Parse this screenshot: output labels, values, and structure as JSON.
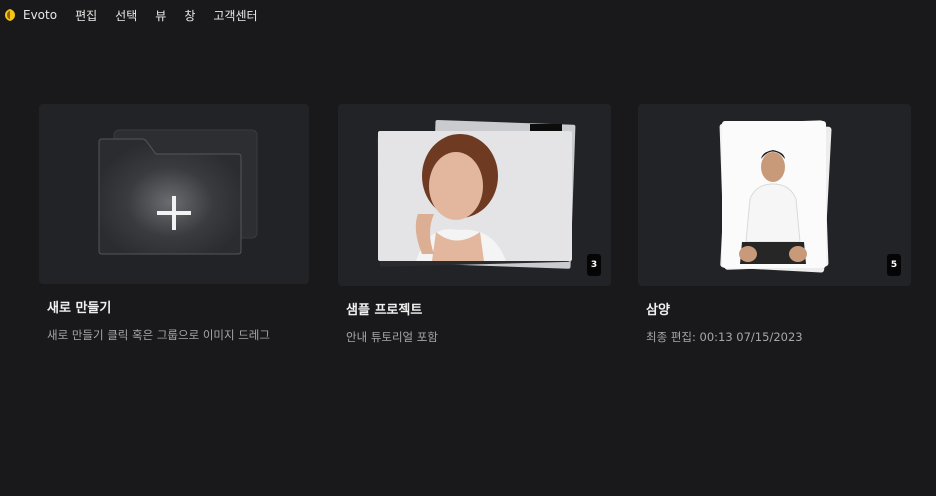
{
  "menubar": {
    "app_name": "Evoto",
    "items": [
      "편집",
      "선택",
      "뷰",
      "창",
      "고객센터"
    ]
  },
  "cards": [
    {
      "title": "새로 만들기",
      "subtitle": "새로 만들기 클릭 혹은 그룹으로 이미지 드레그",
      "icon": "folder-plus-icon"
    },
    {
      "title": "샘플 프로젝트",
      "subtitle": "안내 튜토리얼 포함",
      "count": "3"
    },
    {
      "title": "삼양",
      "subtitle": "최종 편집: 00:13 07/15/2023",
      "count": "5"
    }
  ],
  "colors": {
    "background": "#19191b",
    "card": "#222326",
    "logo": "#f5c518"
  }
}
